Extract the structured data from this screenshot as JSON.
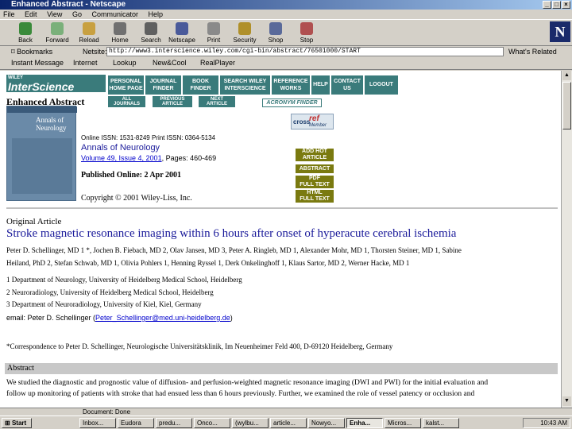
{
  "window": {
    "title": "Enhanced Abstract - Netscape",
    "menu": [
      "File",
      "Edit",
      "View",
      "Go",
      "Communicator",
      "Help"
    ]
  },
  "toolbar": {
    "buttons": [
      "Back",
      "Forward",
      "Reload",
      "Home",
      "Search",
      "Netscape",
      "Print",
      "Security",
      "Shop",
      "Stop"
    ]
  },
  "location": {
    "bookmarks_label": "Bookmarks",
    "netsite_label": "Netsite:",
    "url": "http://www3.interscience.wiley.com/cgi-bin/abstract/76501000/START",
    "related_label": "What's Related"
  },
  "personal_bar": [
    "Instant Message",
    "Internet",
    "Lookup",
    "New&Cool",
    "RealPlayer"
  ],
  "page": {
    "logo_top": "WILEY",
    "logo_main": "InterScience",
    "enhanced_abstract": "Enhanced Abstract",
    "nav": [
      {
        "l1": "PERSONAL",
        "l2": "HOME PAGE"
      },
      {
        "l1": "JOURNAL",
        "l2": "FINDER"
      },
      {
        "l1": "BOOK",
        "l2": "FINDER"
      },
      {
        "l1": "SEARCH WILEY",
        "l2": "INTERSCIENCE"
      },
      {
        "l1": "REFERENCE",
        "l2": "WORKS"
      },
      {
        "l1": "HELP",
        "l2": ""
      },
      {
        "l1": "CONTACT",
        "l2": "US"
      },
      {
        "l1": "LOGOUT",
        "l2": ""
      }
    ],
    "subnav": [
      {
        "l1": "ALL",
        "l2": "JOURNALS"
      },
      {
        "l1": "PREVIOUS",
        "l2": "ARTICLE"
      },
      {
        "l1": "NEXT",
        "l2": "ARTICLE"
      }
    ],
    "acronym_finder": "ACRONYM FINDER",
    "cover_title": "Annals of Neurology",
    "issn": "Online ISSN: 1531-8249   Print ISSN: 0364-5134",
    "journal_name": "Annals of Neurology",
    "volume_link": "Volume 49, Issue 4, 2001",
    "pages": ", Pages: 460-469",
    "published": "Published Online: 2 Apr 2001",
    "copyright": "Copyright © 2001 Wiley-Liss, Inc.",
    "crossref": "cross",
    "crossref_ref": "ref",
    "crossref_member": "Member",
    "side_buttons": [
      {
        "l1": "ADD HOT",
        "l2": "ARTICLE"
      },
      {
        "l1": "ABSTRACT",
        "l2": ""
      },
      {
        "l1": "PDF",
        "l2": "FULL TEXT"
      },
      {
        "l1": "HTML",
        "l2": "FULL TEXT"
      }
    ],
    "original_article": "Original Article",
    "article_title": "Stroke magnetic resonance imaging within 6 hours after onset of hyperacute cerebral ischemia",
    "authors_1": "Peter D. Schellinger, MD 1 *, Jochen B. Fiebach, MD 2, Olav Jansen, MD 3, Peter A. Ringleb, MD 1, Alexander Mohr, MD 1, Thorsten Steiner, MD 1, Sabine",
    "authors_2": "Heiland, PhD 2, Stefan Schwab, MD 1, Olivia Pohlers 1, Henning Ryssel 1, Derk Onkelinghoff 1, Klaus Sartor, MD 2, Werner Hacke, MD 1",
    "affil_1": "1 Department of Neurology, University of Heidelberg Medical School, Heidelberg",
    "affil_2": "2 Neuroradiology, University of Heidelberg Medical School, Heidelberg",
    "affil_3": "3 Department of Neuroradiology, University of Kiel, Kiel, Germany",
    "email_label": "email: Peter D. Schellinger (",
    "email_addr": "Peter_Schellinger@med.uni-heidelberg.de",
    "email_close": ")",
    "correspondence": "*Correspondence to Peter D. Schellinger, Neurologische Universitätsklinik, Im Neuenheimer Feld 400, D-69120 Heidelberg, Germany",
    "abstract_heading": "Abstract",
    "abstract_1": "We studied the diagnostic and prognostic value of diffusion- and perfusion-weighted magnetic resonance imaging (DWI and PWI) for the initial evaluation and",
    "abstract_2": "follow up monitoring of patients with stroke that had ensued less than 6 hours previously. Further, we examined the role of vessel patency or occlusion and"
  },
  "status": "Document: Done",
  "taskbar": {
    "start": "Start",
    "tasks": [
      "Inbox...",
      "Eudora",
      "predu...",
      "Onco...",
      "(wylbu...",
      "article...",
      "Nowyo...",
      "Enha...",
      "Micros...",
      "kalst..."
    ],
    "clock": "10:43 AM"
  },
  "colors": {
    "teal": "#3a7b7b",
    "olive": "#7a7a10",
    "link": "#0000cc",
    "heading_blue": "#1a1a9a"
  }
}
